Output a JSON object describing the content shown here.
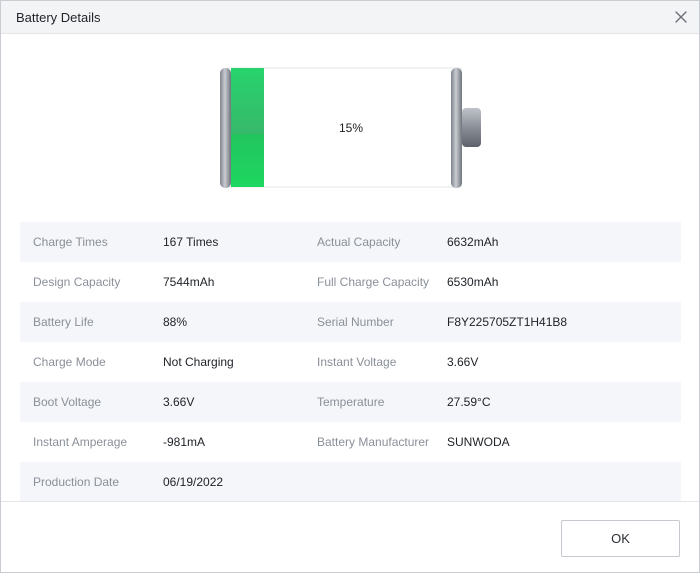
{
  "window": {
    "title": "Battery Details"
  },
  "battery": {
    "percent_label": "15%",
    "level": 0.15,
    "fill_color": "#2ecc71",
    "icon": "battery-icon"
  },
  "details": [
    {
      "label1": "Charge Times",
      "value1": "167 Times",
      "label2": "Actual Capacity",
      "value2": "6632mAh"
    },
    {
      "label1": "Design Capacity",
      "value1": "7544mAh",
      "label2": "Full Charge Capacity",
      "value2": "6530mAh"
    },
    {
      "label1": "Battery Life",
      "value1": "88%",
      "label2": "Serial Number",
      "value2": "F8Y225705ZT1H41B8"
    },
    {
      "label1": "Charge Mode",
      "value1": "Not Charging",
      "label2": "Instant Voltage",
      "value2": "3.66V"
    },
    {
      "label1": "Boot Voltage",
      "value1": "3.66V",
      "label2": "Temperature",
      "value2": "27.59°C"
    },
    {
      "label1": "Instant Amperage",
      "value1": "-981mA",
      "label2": "Battery Manufacturer",
      "value2": "SUNWODA"
    },
    {
      "label1": "Production Date",
      "value1": "06/19/2022",
      "label2": "",
      "value2": ""
    }
  ],
  "footer": {
    "ok_label": "OK"
  },
  "colors": {
    "row_alt": "#f4f6f9",
    "label_text": "#8a9099",
    "value_text": "#20242a"
  }
}
